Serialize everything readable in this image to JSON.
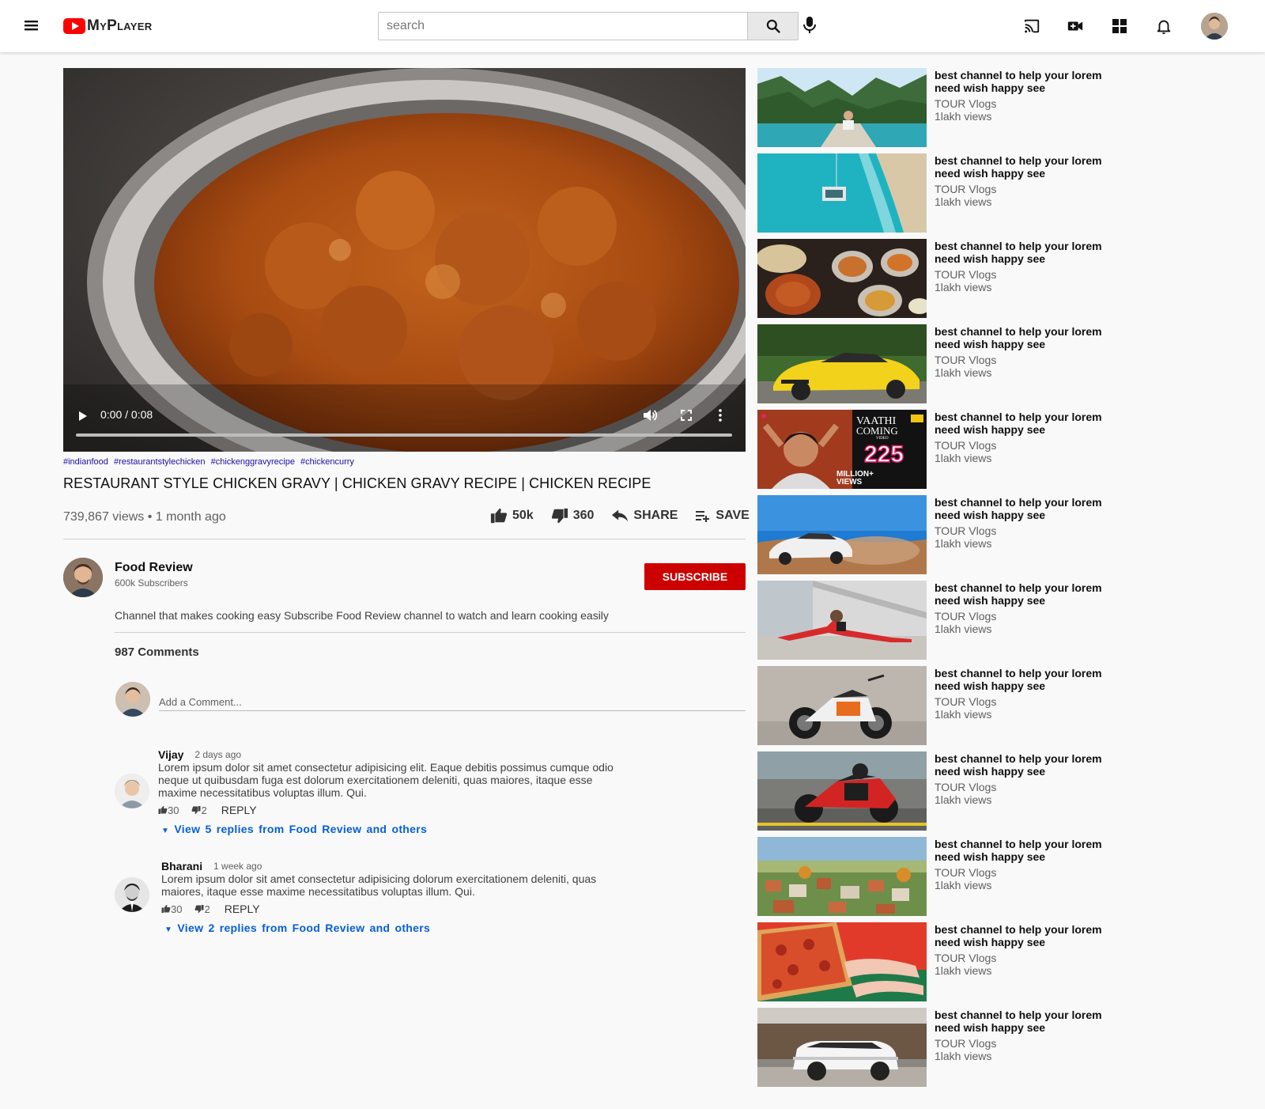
{
  "header": {
    "logo_text": "MyPlayer",
    "search_placeholder": "search"
  },
  "player": {
    "time": "0:00 / 0:08",
    "progress": 0
  },
  "video": {
    "tags": [
      "#indianfood",
      "#restaurantstylechicken",
      "#chickenggravyrecipe",
      "#chickencurry"
    ],
    "title": "RESTAURANT STYLE CHICKEN GRAVY | CHICKEN GRAVY RECIPE | CHICKEN RECIPE",
    "meta": "739,867 views • 1 month ago",
    "likes": "50k",
    "dislikes": "360",
    "share_label": "SHARE",
    "save_label": "SAVE"
  },
  "channel": {
    "name": "Food Review",
    "subscribers": "600k Subscribers",
    "subscribe_label": "SUBSCRIBE",
    "description": "Channel that makes cooking easy Subscribe Food Review channel to watch and learn cooking easily"
  },
  "comments": {
    "count": "987 Comments",
    "input_placeholder": "Add a Comment...",
    "items": [
      {
        "author": "Vijay",
        "time": "2 days ago",
        "text": "Lorem ipsum dolor sit amet consectetur adipisicing elit. Eaque debitis possimus cumque odio neque ut quibusdam fuga est dolorum exercitationem deleniti, quas maiores, itaque esse maxime necessitatibus voluptas illum. Qui.",
        "likes": "30",
        "dislikes": "2",
        "reply_label": "REPLY",
        "view_replies": "View 5 replies from Food Review and others"
      },
      {
        "author": "Bharani",
        "time": "1 week ago",
        "text": "Lorem ipsum dolor sit amet consectetur adipisicing dolorum exercitationem deleniti, quas maiores, itaque esse maxime necessitatibus voluptas illum. Qui.",
        "likes": "30",
        "dislikes": "2",
        "reply_label": "REPLY",
        "view_replies": "View 2 replies from Food Review and others"
      }
    ]
  },
  "recommendations": [
    {
      "title": "best channel to help your lorem need wish happy see",
      "channel": "TOUR Vlogs",
      "views": "1lakh views",
      "thumb": "lake-boat"
    },
    {
      "title": "best channel to help your lorem need wish happy see",
      "channel": "TOUR Vlogs",
      "views": "1lakh views",
      "thumb": "beach-aerial"
    },
    {
      "title": "best channel to help your lorem need wish happy see",
      "channel": "TOUR Vlogs",
      "views": "1lakh views",
      "thumb": "food-table"
    },
    {
      "title": "best channel to help your lorem need wish happy see",
      "channel": "TOUR Vlogs",
      "views": "1lakh views",
      "thumb": "yellow-car"
    },
    {
      "title": "best channel to help your lorem need wish happy see",
      "channel": "TOUR Vlogs",
      "views": "1lakh views",
      "thumb": "vaathi-poster",
      "overlay": {
        "line1": "VAATHI",
        "line2": "COMING",
        "line3": "VIDEO",
        "num": "225",
        "sub1": "MILLION+",
        "sub2": "VIEWS"
      }
    },
    {
      "title": "best channel to help your lorem need wish happy see",
      "channel": "TOUR Vlogs",
      "views": "1lakh views",
      "thumb": "white-car-dust"
    },
    {
      "title": "best channel to help your lorem need wish happy see",
      "channel": "TOUR Vlogs",
      "views": "1lakh views",
      "thumb": "stretching-woman"
    },
    {
      "title": "best channel to help your lorem need wish happy see",
      "channel": "TOUR Vlogs",
      "views": "1lakh views",
      "thumb": "motorbike-white"
    },
    {
      "title": "best channel to help your lorem need wish happy see",
      "channel": "TOUR Vlogs",
      "views": "1lakh views",
      "thumb": "motorbike-race"
    },
    {
      "title": "best channel to help your lorem need wish happy see",
      "channel": "TOUR Vlogs",
      "views": "1lakh views",
      "thumb": "town-aerial"
    },
    {
      "title": "best channel to help your lorem need wish happy see",
      "channel": "TOUR Vlogs",
      "views": "1lakh views",
      "thumb": "pizza"
    },
    {
      "title": "best channel to help your lorem need wish happy see",
      "channel": "TOUR Vlogs",
      "views": "1lakh views",
      "thumb": "white-suv"
    }
  ],
  "colors": {
    "brand": "#ff0000",
    "subscribe": "#cc0000",
    "link": "#065fd4",
    "tag": "#1a0dab"
  }
}
